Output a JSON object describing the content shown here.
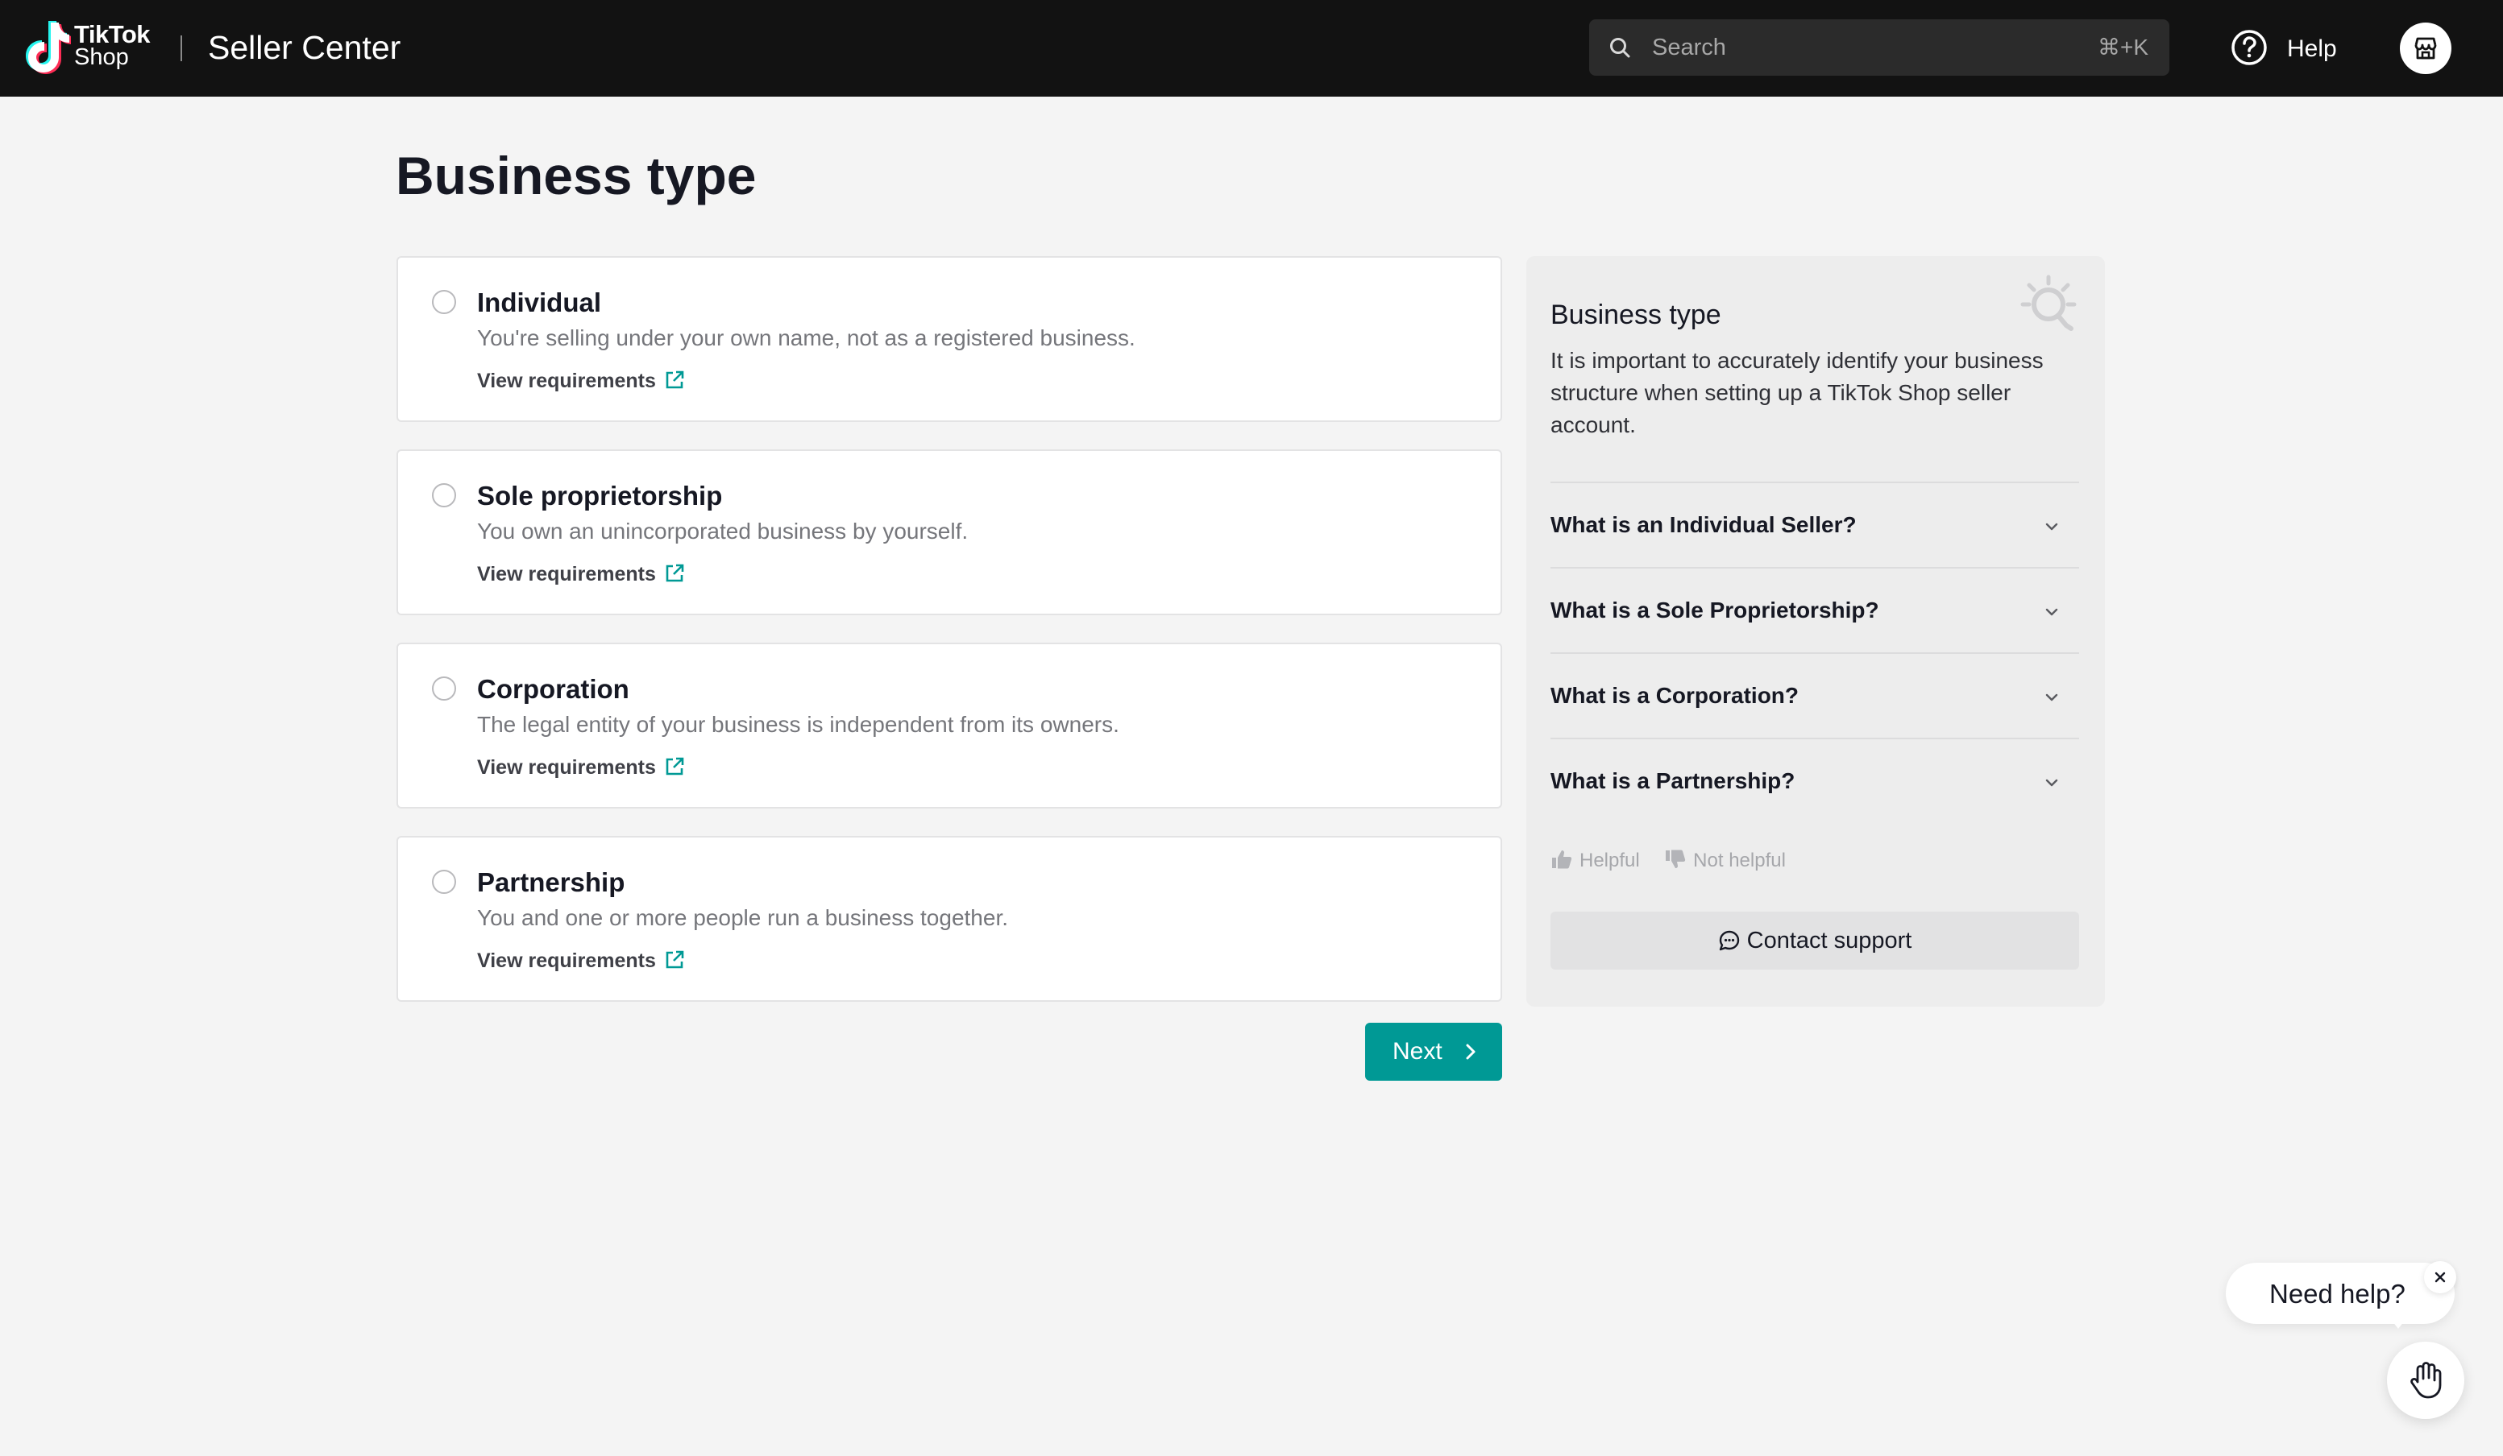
{
  "header": {
    "logo_line1": "TikTok",
    "logo_line2": "Shop",
    "app_name": "Seller Center",
    "search_placeholder": "Search",
    "search_shortcut": "⌘+K",
    "help_label": "Help",
    "icons": [
      "tiktok-logo-icon",
      "search-icon",
      "help-circle-icon",
      "store-icon"
    ]
  },
  "page": {
    "title": "Business type"
  },
  "options": [
    {
      "title": "Individual",
      "description": "You're selling under your own name, not as a registered business.",
      "link": "View requirements",
      "selected": false
    },
    {
      "title": "Sole proprietorship",
      "description": "You own an unincorporated business by yourself.",
      "link": "View requirements",
      "selected": false
    },
    {
      "title": "Corporation",
      "description": "The legal entity of your business is independent from its owners.",
      "link": "View requirements",
      "selected": false
    },
    {
      "title": "Partnership",
      "description": "You and one or more people run a business together.",
      "link": "View requirements",
      "selected": false
    }
  ],
  "next_label": "Next",
  "panel": {
    "title": "Business type",
    "description": "It is important to accurately identify your business structure when setting up a TikTok Shop seller account.",
    "faqs": [
      "What is an Individual Seller?",
      "What is a Sole Proprietorship?",
      "What is a Corporation?",
      "What is a Partnership?"
    ],
    "helpful_label": "Helpful",
    "not_helpful_label": "Not helpful",
    "contact_label": "Contact support"
  },
  "chat_widget": {
    "prompt": "Need help?"
  },
  "colors": {
    "topbar": "#121212",
    "accent": "#009995",
    "page_bg": "#f4f4f4",
    "panel_bg": "#ededed"
  }
}
